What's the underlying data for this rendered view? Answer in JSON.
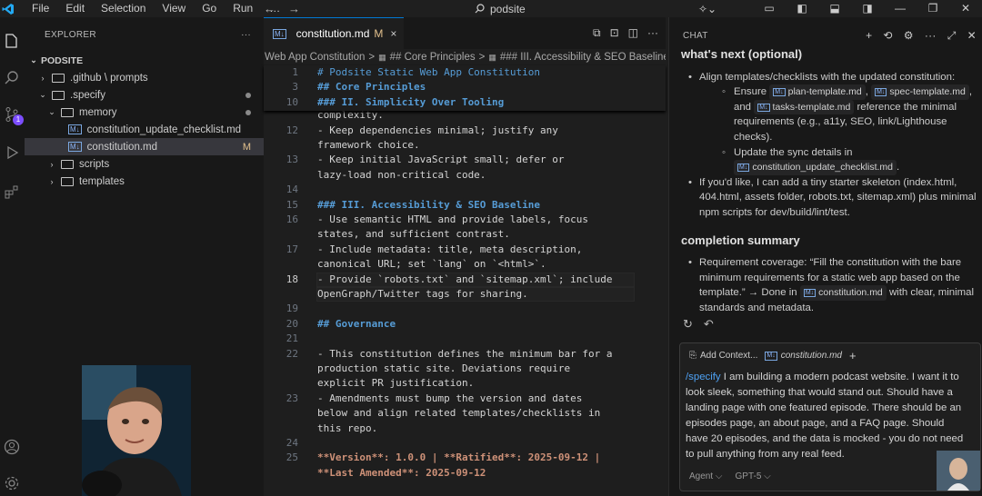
{
  "titlebar": {
    "menu": [
      "File",
      "Edit",
      "Selection",
      "View",
      "Go",
      "Run",
      "…"
    ],
    "search_text": "podsite"
  },
  "activity_bar": {
    "icons": [
      "explorer-icon",
      "search-icon",
      "source-control-icon",
      "run-debug-icon",
      "extensions-icon",
      "accounts-icon",
      "settings-gear-icon"
    ],
    "source_control_badge": "1"
  },
  "sidebar": {
    "header": "EXPLORER",
    "more": "···",
    "root": "PODSITE",
    "items": [
      {
        "label": ".github \\ prompts",
        "level": 1,
        "kind": "folder",
        "expanded": false
      },
      {
        "label": ".specify",
        "level": 1,
        "kind": "folder",
        "expanded": true,
        "dot": true
      },
      {
        "label": "memory",
        "level": 2,
        "kind": "folder",
        "expanded": true,
        "dot": true
      },
      {
        "label": "constitution_update_checklist.md",
        "level": 3,
        "kind": "file"
      },
      {
        "label": "constitution.md",
        "level": 3,
        "kind": "file",
        "selected": true,
        "status": "M"
      },
      {
        "label": "scripts",
        "level": 2,
        "kind": "folder",
        "expanded": false
      },
      {
        "label": "templates",
        "level": 2,
        "kind": "folder",
        "expanded": false
      }
    ]
  },
  "editor": {
    "tab": {
      "label": "constitution.md",
      "status": "M",
      "close": "×"
    },
    "breadcrumb": [
      "Web App Constitution",
      "## Core Principles",
      "### III. Accessibility & SEO Baseline"
    ],
    "breadcrumb_sep": ">",
    "sticky_lines": [
      {
        "n": "1",
        "text": "# Podsite Static Web App Constitution"
      },
      {
        "n": "3",
        "text": "## Core Principles"
      },
      {
        "n": "10",
        "text": "### II. Simplicity Over Tooling"
      }
    ],
    "lines": [
      {
        "n": "",
        "text": "complexity."
      },
      {
        "n": "12",
        "text": "- Keep dependencies minimal; justify any"
      },
      {
        "n": "",
        "text": "framework choice."
      },
      {
        "n": "13",
        "text": "- Keep initial JavaScript small; defer or"
      },
      {
        "n": "",
        "text": "lazy-load non-critical code."
      },
      {
        "n": "14",
        "text": ""
      },
      {
        "n": "15",
        "text": "### III. Accessibility & SEO Baseline"
      },
      {
        "n": "16",
        "text": "- Use semantic HTML and provide labels, focus"
      },
      {
        "n": "",
        "text": "states, and sufficient contrast."
      },
      {
        "n": "17",
        "text": "- Include metadata: title, meta description,"
      },
      {
        "n": "",
        "text": "canonical URL; set `lang` on `<html>`."
      },
      {
        "n": "18",
        "text": "- Provide `robots.txt` and `sitemap.xml`; include"
      },
      {
        "n": "",
        "text": "OpenGraph/Twitter tags for sharing."
      },
      {
        "n": "19",
        "text": ""
      },
      {
        "n": "20",
        "text": "## Governance"
      },
      {
        "n": "21",
        "text": ""
      },
      {
        "n": "22",
        "text": "- This constitution defines the minimum bar for a"
      },
      {
        "n": "",
        "text": "production static site. Deviations require"
      },
      {
        "n": "",
        "text": "explicit PR justification."
      },
      {
        "n": "23",
        "text": "- Amendments must bump the version and dates"
      },
      {
        "n": "",
        "text": "below and align related templates/checklists in"
      },
      {
        "n": "",
        "text": "this repo."
      },
      {
        "n": "24",
        "text": ""
      },
      {
        "n": "25",
        "text": "**Version**: 1.0.0 | **Ratified**: 2025-09-12 |"
      },
      {
        "n": "",
        "text": "**Last Amended**: 2025-09-12"
      }
    ]
  },
  "chat": {
    "header": "CHAT",
    "next_heading": "what's next (optional)",
    "next_items": {
      "align_intro": "Align templates/checklists with the updated constitution:",
      "ensure_prefix": "Ensure",
      "file_plan": "plan-template.md",
      "file_spec": "spec-template.md",
      "and": ", and",
      "file_tasks": "tasks-template.md",
      "reference_text": "reference the minimal requirements (e.g., a11y, SEO, link/Lighthouse checks).",
      "sync_text": "Update the sync details in",
      "file_checklist": "constitution_update_checklist.md",
      "period": ".",
      "skeleton": "If you'd like, I can add a tiny starter skeleton (index.html, 404.html, assets folder, robots.txt, sitemap.xml) plus minimal npm scripts for dev/build/lint/test."
    },
    "summary_heading": "completion summary",
    "summary_item": {
      "prefix": "Requirement coverage: “Fill the constitution with the bare minimum requirements for a static web app based on the template.” → Done in",
      "file": "constitution.md",
      "suffix": "with clear, minimal standards and metadata."
    },
    "input": {
      "add_context": "Add Context...",
      "attached_file": "constitution.md",
      "plus": "+",
      "command": "/specify",
      "text": " I am building a modern podcast website. I want it to look sleek, something that would stand out. Should have a landing page with one featured episode. There should be an episodes page, an about page, and a FAQ page. Should have 20 episodes, and the data is mocked - you do not need to pull anything from any real feed.",
      "mode": "Agent ⌵",
      "model": "GPT-5 ⌵"
    }
  },
  "colors": {
    "accent": "#0078d4",
    "modified": "#e2c08d",
    "heading": "#569cd6",
    "code_span": "#ce9178",
    "link": "#4ea1f3"
  }
}
